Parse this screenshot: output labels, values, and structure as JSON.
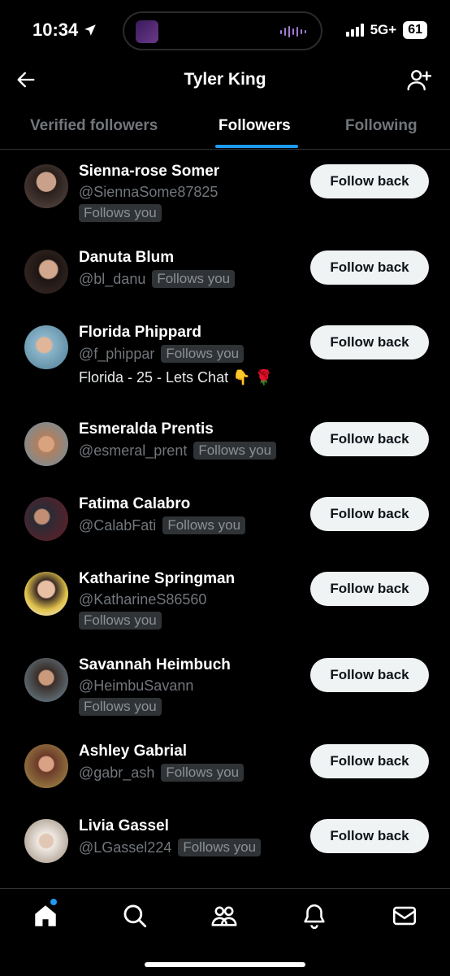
{
  "status_bar": {
    "time": "10:34",
    "network": "5G+",
    "battery": "61"
  },
  "header": {
    "title": "Tyler King"
  },
  "tabs": [
    {
      "label": "Verified followers",
      "active": false
    },
    {
      "label": "Followers",
      "active": true
    },
    {
      "label": "Following",
      "active": false
    }
  ],
  "follow_button_label": "Follow back",
  "followers": [
    {
      "name": "Sienna-rose Somer",
      "handle": "@SiennaSome87825",
      "badge": "Follows you",
      "bio": ""
    },
    {
      "name": "Danuta Blum",
      "handle": "@bl_danu",
      "badge": "Follows you",
      "bio": ""
    },
    {
      "name": "Florida Phippard",
      "handle": "@f_phippar",
      "badge": "Follows you",
      "bio": "Florida - 25 - Lets Chat 👇 🌹"
    },
    {
      "name": "Esmeralda Prentis",
      "handle": "@esmeral_prent",
      "badge": "Follows you",
      "bio": ""
    },
    {
      "name": "Fatima Calabro",
      "handle": "@CalabFati",
      "badge": "Follows you",
      "bio": ""
    },
    {
      "name": "Katharine Springman",
      "handle": "@KatharineS86560",
      "badge": "Follows you",
      "bio": ""
    },
    {
      "name": "Savannah Heimbuch",
      "handle": "@HeimbuSavann",
      "badge": "Follows you",
      "bio": ""
    },
    {
      "name": "Ashley Gabrial",
      "handle": "@gabr_ash",
      "badge": "Follows you",
      "bio": ""
    },
    {
      "name": "Livia Gassel",
      "handle": "@LGassel224",
      "badge": "Follows you",
      "bio": ""
    }
  ],
  "bottom_nav": [
    "home-icon",
    "search-icon",
    "communities-icon",
    "notifications-icon",
    "messages-icon"
  ],
  "colors": {
    "background": "#000000",
    "accent": "#1d9bf0",
    "muted_text": "#71767b",
    "button_bg": "#eff3f4"
  }
}
